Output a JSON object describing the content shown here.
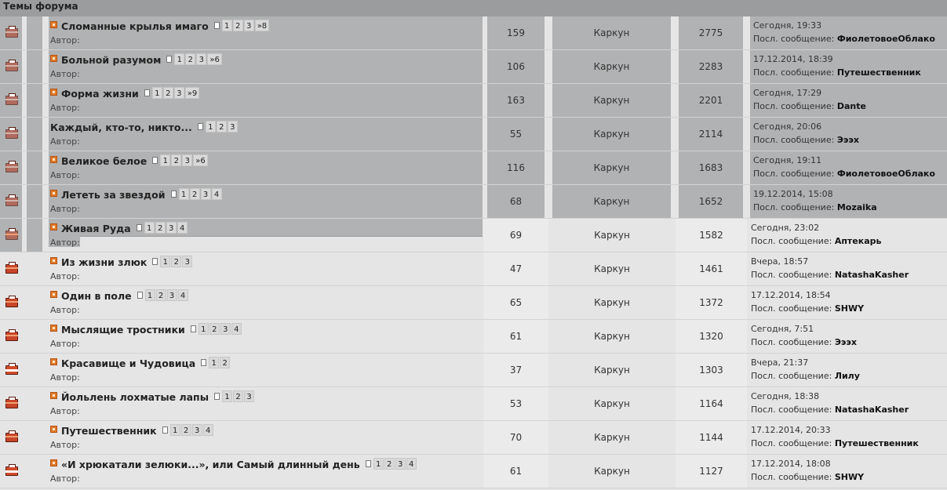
{
  "header": {
    "title": "Темы форума"
  },
  "labels": {
    "author": "Автор:",
    "last_post_prefix": "Посл. сообщение:"
  },
  "topics": [
    {
      "title": "Сломанные крылья имаго",
      "pages": [
        "1",
        "2",
        "3",
        "»8"
      ],
      "replies": "159",
      "author": "Каркун",
      "views": "2775",
      "last_date": "Сегодня, 19:33",
      "last_user": "ФиолетовоеОблако",
      "icon": "folder-icon",
      "new_icon": true
    },
    {
      "title": "Больной разумом",
      "pages": [
        "1",
        "2",
        "3",
        "»6"
      ],
      "replies": "106",
      "author": "Каркун",
      "views": "2283",
      "last_date": "17.12.2014, 18:39",
      "last_user": "Путешественник",
      "icon": "folder-icon",
      "new_icon": true
    },
    {
      "title": "Форма жизни",
      "pages": [
        "1",
        "2",
        "3",
        "»9"
      ],
      "replies": "163",
      "author": "Каркун",
      "views": "2201",
      "last_date": "Сегодня, 17:29",
      "last_user": "Dante",
      "icon": "folder-icon",
      "new_icon": true
    },
    {
      "title": "Каждый, кто-то, никто...",
      "pages": [
        "1",
        "2",
        "3"
      ],
      "replies": "55",
      "author": "Каркун",
      "views": "2114",
      "last_date": "Сегодня, 20:06",
      "last_user": "Эээх",
      "icon": "folder-icon",
      "new_icon": false
    },
    {
      "title": "Великое белое",
      "pages": [
        "1",
        "2",
        "3",
        "»6"
      ],
      "replies": "116",
      "author": "Каркун",
      "views": "1683",
      "last_date": "Сегодня, 19:11",
      "last_user": "ФиолетовоеОблако",
      "icon": "folder-icon",
      "new_icon": true
    },
    {
      "title": "Лететь за звездой",
      "pages": [
        "1",
        "2",
        "3",
        "4"
      ],
      "replies": "68",
      "author": "Каркун",
      "views": "1652",
      "last_date": "19.12.2014, 15:08",
      "last_user": "Mozaika",
      "icon": "folder-icon",
      "new_icon": true
    },
    {
      "title": "Живая Руда",
      "pages": [
        "1",
        "2",
        "3",
        "4"
      ],
      "replies": "69",
      "author": "Каркун",
      "views": "1582",
      "last_date": "Сегодня, 23:02",
      "last_user": "Аптекарь",
      "icon": "folder-icon",
      "new_icon": true
    },
    {
      "title": "Из жизни злюк",
      "pages": [
        "1",
        "2",
        "3"
      ],
      "replies": "47",
      "author": "Каркун",
      "views": "1461",
      "last_date": "Вчера, 18:57",
      "last_user": "NatashaKasher",
      "icon": "folder-icon",
      "new_icon": true
    },
    {
      "title": "Один в поле",
      "pages": [
        "1",
        "2",
        "3",
        "4"
      ],
      "replies": "65",
      "author": "Каркун",
      "views": "1372",
      "last_date": "17.12.2014, 18:54",
      "last_user": "SHWY",
      "icon": "folder-icon",
      "new_icon": true
    },
    {
      "title": "Мыслящие тростники",
      "pages": [
        "1",
        "2",
        "3",
        "4"
      ],
      "replies": "61",
      "author": "Каркун",
      "views": "1320",
      "last_date": "Сегодня, 7:51",
      "last_user": "Эээх",
      "icon": "folder-icon",
      "new_icon": true
    },
    {
      "title": "Красавище и Чудовица",
      "pages": [
        "1",
        "2"
      ],
      "replies": "37",
      "author": "Каркун",
      "views": "1303",
      "last_date": "Вчера, 21:37",
      "last_user": "Лилу",
      "icon": "hot-folder-icon",
      "new_icon": true
    },
    {
      "title": "Йольлень лохматые лапы",
      "pages": [
        "1",
        "2",
        "3"
      ],
      "replies": "53",
      "author": "Каркун",
      "views": "1164",
      "last_date": "Сегодня, 18:38",
      "last_user": "NatashaKasher",
      "icon": "folder-icon",
      "new_icon": true
    },
    {
      "title": "Путешественник",
      "pages": [
        "1",
        "2",
        "3",
        "4"
      ],
      "replies": "70",
      "author": "Каркун",
      "views": "1144",
      "last_date": "17.12.2014, 20:33",
      "last_user": "Путешественник",
      "icon": "folder-icon",
      "new_icon": true
    },
    {
      "title": "«И хрюкатали зелюки...», или Самый длинный день",
      "pages": [
        "1",
        "2",
        "3",
        "4"
      ],
      "replies": "61",
      "author": "Каркун",
      "views": "1127",
      "last_date": "17.12.2014, 18:08",
      "last_user": "SHWY",
      "icon": "hot-folder-icon",
      "new_icon": true
    }
  ],
  "selection": {
    "selected_rows": 6,
    "partial_row": 6
  }
}
